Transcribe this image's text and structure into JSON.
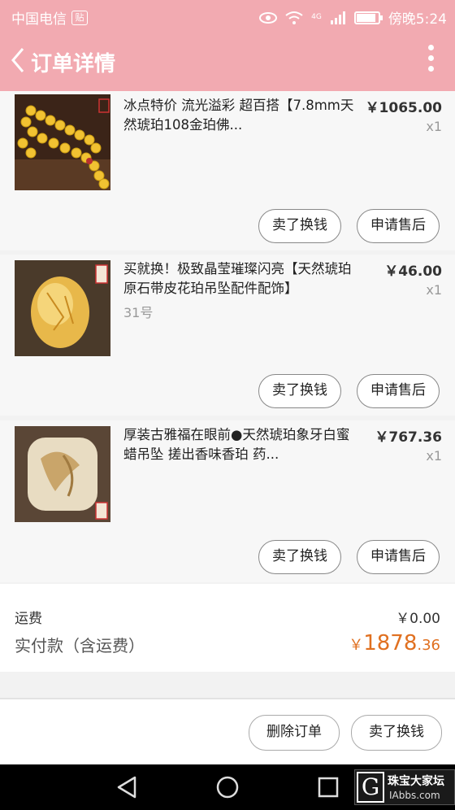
{
  "status_bar": {
    "carrier": "中国电信",
    "carrier_badge": "贴",
    "signal": "4G",
    "time": "傍晚5:24"
  },
  "header": {
    "title": "订单详情"
  },
  "colors": {
    "header_bg": "#f2aab1",
    "accent_price": "#e07020"
  },
  "items": [
    {
      "name": "冰点特价 流光溢彩 超百搭【7.8mm天然琥珀108金珀佛...",
      "sub": "",
      "price": "￥1065.00",
      "qty": "x1",
      "btn_sell": "卖了换钱",
      "btn_after": "申请售后"
    },
    {
      "name": "买就换！极致晶莹璀璨闪亮【天然琥珀原石带皮花珀吊坠配件配饰】",
      "sub": "31号",
      "price": "￥46.00",
      "qty": "x1",
      "btn_sell": "卖了换钱",
      "btn_after": "申请售后"
    },
    {
      "name": "厚装古雅福在眼前●天然琥珀象牙白蜜蜡吊坠 搓出香味香珀 药...",
      "sub": "",
      "price": "￥767.36",
      "qty": "x1",
      "btn_sell": "卖了换钱",
      "btn_after": "申请售后"
    }
  ],
  "summary": {
    "shipping_label": "运费",
    "shipping_value": "￥0.00",
    "paid_label": "实付款（含运费）",
    "paid_currency": "￥",
    "paid_int": "1878",
    "paid_dec": ".36"
  },
  "actions": {
    "delete": "删除订单",
    "sell": "卖了换钱"
  },
  "watermark": {
    "logo": "G",
    "line1": "珠宝大家坛",
    "line2": "IAbbs.com"
  }
}
